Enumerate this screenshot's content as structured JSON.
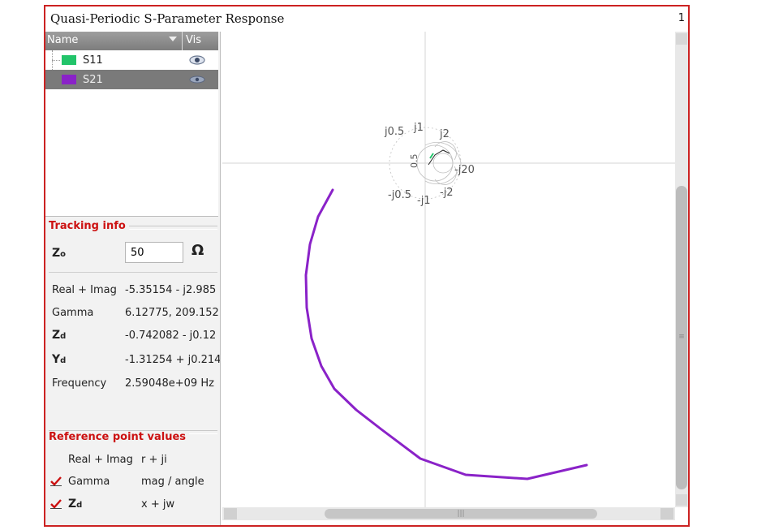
{
  "window": {
    "title": "Quasi-Periodic S-Parameter Response",
    "number": "1"
  },
  "tree": {
    "col_name": "Name",
    "col_vis": "Vis",
    "items": [
      {
        "label": "S11",
        "color": "#22c46a",
        "selected": false
      },
      {
        "label": "S21",
        "color": "#8a22c8",
        "selected": true
      }
    ]
  },
  "tracking": {
    "title": "Tracking info",
    "zo_label": "Z",
    "zo_sub": "o",
    "zo_value": "50",
    "zo_unit": "Ω",
    "rows": [
      {
        "label": "Real + Imag",
        "value": "-5.35154 - j2.985"
      },
      {
        "label": "Gamma",
        "value": "6.12775, 209.152"
      },
      {
        "label": "Z",
        "sub": "d",
        "value": "-0.742082 - j0.12"
      },
      {
        "label": "Y",
        "sub": "d",
        "value": "-1.31254 + j0.214"
      },
      {
        "label": "Frequency",
        "value": "2.59048e+09 Hz"
      }
    ]
  },
  "reference": {
    "title": "Reference point values",
    "rows": [
      {
        "label": "Real + Imag",
        "value": "r + ji",
        "checked": false
      },
      {
        "label": "Gamma",
        "value": "mag / angle",
        "checked": true
      },
      {
        "label": "Z",
        "sub": "d",
        "value": "x + jw",
        "checked": true
      }
    ]
  },
  "smith_labels": {
    "top_a": "j0.5",
    "top_b": "j1",
    "top_c": "j2",
    "right": "-j20",
    "bottom_a": "-j0.5",
    "bottom_b": "-j1",
    "bottom_c": "-j2",
    "center": "0.5"
  },
  "colors": {
    "accent_red": "#cc1111",
    "s21_trace": "#8a22c8",
    "s11_swatch": "#22c46a"
  }
}
